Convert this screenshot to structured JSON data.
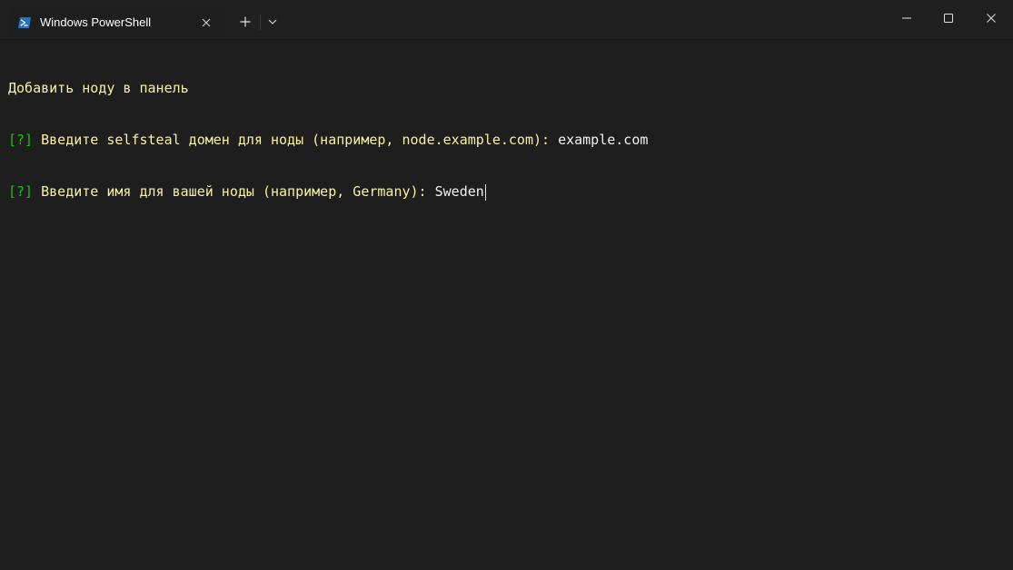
{
  "window": {
    "tab_title": "Windows PowerShell",
    "tab_icon": "powershell-icon",
    "close_tab_icon": "close-icon",
    "new_tab_icon": "plus-icon",
    "dropdown_icon": "chevron-down-icon",
    "minimize_icon": "minimize-icon",
    "maximize_icon": "maximize-icon",
    "close_window_icon": "close-icon"
  },
  "colors": {
    "background": "#1e1e1e",
    "titlebar": "#202020",
    "prompt_text": "#f9f1a5",
    "prompt_marker": "#16c60c",
    "user_input": "#f2f2f2",
    "powershell_blue": "#2671be"
  },
  "terminal": {
    "heading": "Добавить ноду в панель",
    "prompts": [
      {
        "marker": "[?]",
        "text": " Введите selfsteal домен для ноды (например, node.example.com): ",
        "input": "example.com"
      },
      {
        "marker": "[?]",
        "text": " Введите имя для вашей ноды (например, Germany): ",
        "input": "Sweden"
      }
    ]
  }
}
